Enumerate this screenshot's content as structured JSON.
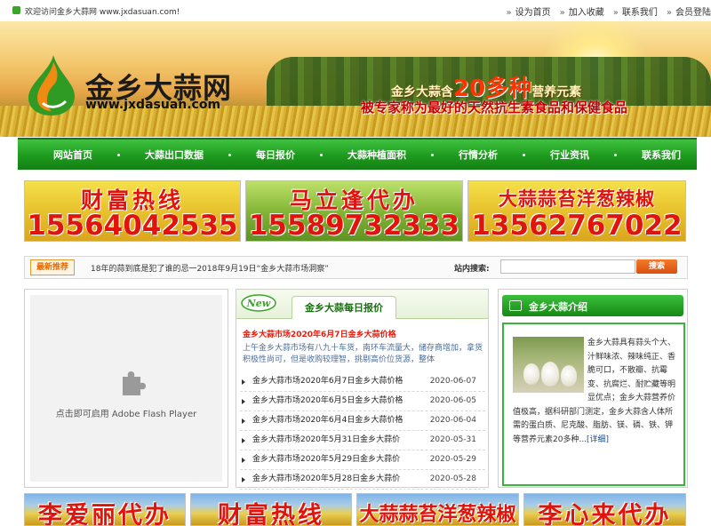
{
  "topbar": {
    "welcome": "欢迎访问金乡大蒜网 www.jxdasuan.com!",
    "links": [
      "设为首页",
      "加入收藏",
      "联系我们",
      "会员登陆"
    ]
  },
  "banner": {
    "site_name": "金乡大蒜网",
    "site_url": "www.jxdasuan.com",
    "slogan_prefix": "金乡大蒜含",
    "slogan_highlight": "20多种",
    "slogan_suffix": "营养元素",
    "slogan_line2": "被专家称为最好的天然抗生素食品和保健食品"
  },
  "nav": {
    "items": [
      "网站首页",
      "大蒜出口数据",
      "每日报价",
      "大蒜种植面积",
      "行情分析",
      "行业资讯",
      "联系我们"
    ]
  },
  "ads_top": [
    {
      "line1": "财富热线",
      "line2": "15564042535"
    },
    {
      "line1": "马立逢代办",
      "line2": "15589732333"
    },
    {
      "line1": "大蒜蒜苔洋葱辣椒",
      "line2": "13562767022"
    }
  ],
  "notice": {
    "tag": "最新推荐",
    "text": "18年的蒜到底是犯了谁的忌一2018年9月19日“金乡大蒜市场洞察”",
    "search_label": "站内搜索:",
    "search_value": "",
    "search_button": "搜索"
  },
  "flash": {
    "text": "点击即可启用 Adobe Flash Player",
    "icon": "puzzle-icon"
  },
  "quotes": {
    "badge": "New",
    "tab_title": "金乡大蒜每日报价",
    "headline": "金乡大蒜市场2020年6月7日金乡大蒜价格",
    "summary": "上午金乡大蒜市场有八九十车货，南环车流量大，储存商增加，拿货积极性尚可，但是收购较理智，挑剔高价位货源，整体",
    "items": [
      {
        "title": "金乡大蒜市场2020年6月7日金乡大蒜价格",
        "date": "2020-06-07"
      },
      {
        "title": "金乡大蒜市场2020年6月5日金乡大蒜价格",
        "date": "2020-06-05"
      },
      {
        "title": "金乡大蒜市场2020年6月4日金乡大蒜价格",
        "date": "2020-06-04"
      },
      {
        "title": "金乡大蒜市场2020年5月31日金乡大蒜价",
        "date": "2020-05-31"
      },
      {
        "title": "金乡大蒜市场2020年5月29日金乡大蒜价",
        "date": "2020-05-29"
      },
      {
        "title": "金乡大蒜市场2020年5月28日金乡大蒜价",
        "date": "2020-05-28"
      }
    ]
  },
  "intro": {
    "title": "金乡大蒜介绍",
    "text": "金乡大蒜具有蒜头个大、汁鲜味浓、辣味纯正、香脆可口，不散瓣、抗霉变、抗腐烂、耐贮藏等明显优点；金乡大蒜营养价值极高，据科研部门测定，金乡大蒜含人体所需的蛋白质、尼克酸、脂肪、镁、磷、铁、钾等营养元素20多种...",
    "more": "[详细]"
  },
  "ads_bottom": [
    "李爱丽代办",
    "财富热线",
    "大蒜蒜苔洋葱辣椒",
    "李心来代办"
  ],
  "colors": {
    "nav_green": "#1e9a1e",
    "ad_red": "#e0140c",
    "headline_red": "#e81b0c",
    "search_orange": "#d94f0f"
  }
}
